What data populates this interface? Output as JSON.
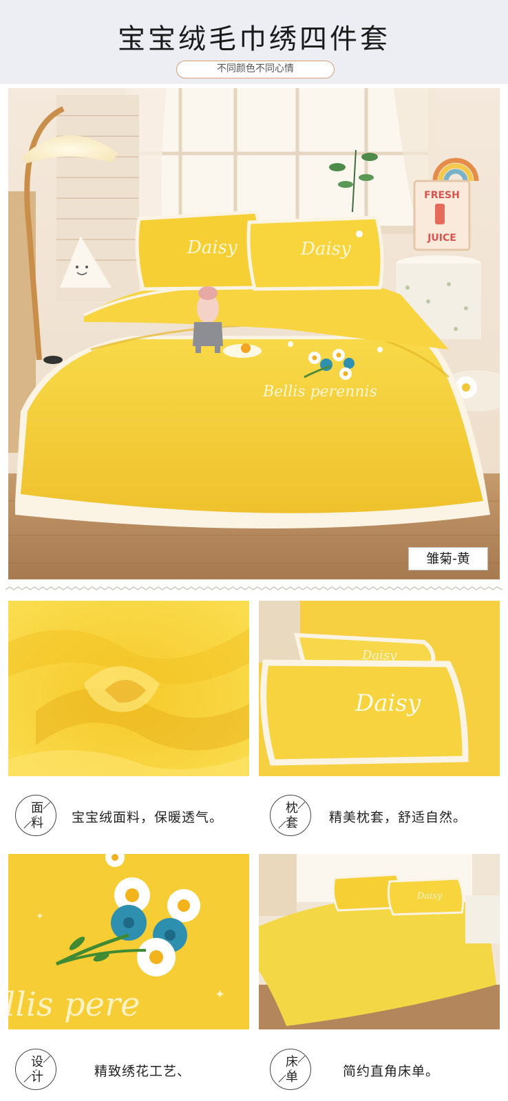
{
  "header": {
    "title": "宝宝绒毛巾绣四件套",
    "subtitle": "不同颜色不同心情"
  },
  "hero": {
    "color_tag": "雏菊-黄",
    "pillow_text": "Daisy",
    "script_text": "Bellis perennis",
    "sign_lines": [
      "FRESH",
      "JUICE"
    ]
  },
  "tiles": {
    "pillow_text": "Daisy",
    "script_text": "llis pere"
  },
  "features": [
    {
      "char1": "面",
      "char2": "料",
      "text": "宝宝绒面料，保暖透气。"
    },
    {
      "char1": "枕",
      "char2": "套",
      "text": "精美枕套，舒适自然。"
    },
    {
      "char1": "设",
      "char2": "计",
      "text": "精致绣花工艺、"
    },
    {
      "char1": "床",
      "char2": "单",
      "text": "简约直角床单。"
    }
  ],
  "colors": {
    "header_bg": "#eceef3",
    "fabric_yellow": "#f6cf3a",
    "fabric_shadow": "#e8b524",
    "trim_white": "#fbf6ea",
    "floor": "#b58b61",
    "flower_blue": "#2f8fae",
    "flower_white": "#ffffff",
    "subtitle_border": "#d9a078"
  },
  "icons": [
    "lamp-icon",
    "plant-icon",
    "rainbow-icon",
    "doll-icon"
  ]
}
